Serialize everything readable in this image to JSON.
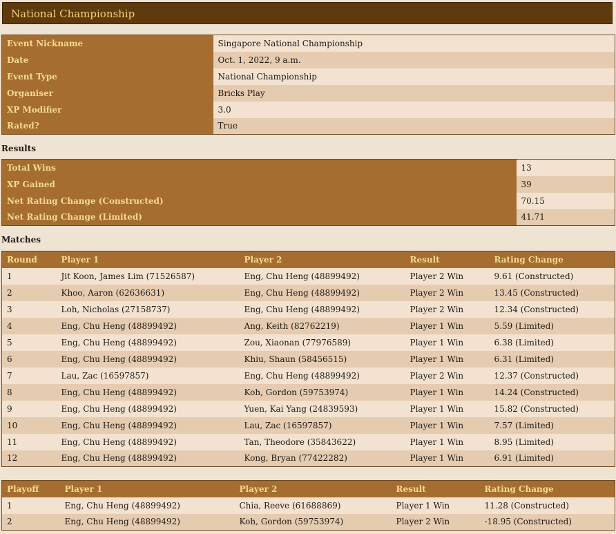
{
  "page_title": "National Championship",
  "event_details": [
    {
      "label": "Event Nickname",
      "value": "Singapore National Championship"
    },
    {
      "label": "Date",
      "value": "Oct. 1, 2022, 9 a.m."
    },
    {
      "label": "Event Type",
      "value": "National Championship"
    },
    {
      "label": "Organiser",
      "value": "Bricks Play"
    },
    {
      "label": "XP Modifier",
      "value": "3.0"
    },
    {
      "label": "Rated?",
      "value": "True"
    }
  ],
  "results": {
    "heading": "Results",
    "rows": [
      {
        "label": "Total Wins",
        "value": "13"
      },
      {
        "label": "XP Gained",
        "value": "39"
      },
      {
        "label": "Net Rating Change (Constructed)",
        "value": "70.15"
      },
      {
        "label": "Net Rating Change (Limited)",
        "value": "41.71"
      }
    ]
  },
  "matches": {
    "heading": "Matches",
    "columns": [
      "Round",
      "Player 1",
      "Player 2",
      "Result",
      "Rating Change"
    ],
    "rows": [
      [
        "1",
        "Jit Koon, James Lim (71526587)",
        "Eng, Chu Heng (48899492)",
        "Player 2 Win",
        "9.61 (Constructed)"
      ],
      [
        "2",
        "Khoo, Aaron (62636631)",
        "Eng, Chu Heng (48899492)",
        "Player 2 Win",
        "13.45 (Constructed)"
      ],
      [
        "3",
        "Loh, Nicholas (27158737)",
        "Eng, Chu Heng (48899492)",
        "Player 2 Win",
        "12.34 (Constructed)"
      ],
      [
        "4",
        "Eng, Chu Heng (48899492)",
        "Ang, Keith (82762219)",
        "Player 1 Win",
        "5.59 (Limited)"
      ],
      [
        "5",
        "Eng, Chu Heng (48899492)",
        "Zou, Xiaonan (77976589)",
        "Player 1 Win",
        "6.38 (Limited)"
      ],
      [
        "6",
        "Eng, Chu Heng (48899492)",
        "Khiu, Shaun (58456515)",
        "Player 1 Win",
        "6.31 (Limited)"
      ],
      [
        "7",
        "Lau, Zac (16597857)",
        "Eng, Chu Heng (48899492)",
        "Player 2 Win",
        "12.37 (Constructed)"
      ],
      [
        "8",
        "Eng, Chu Heng (48899492)",
        "Koh, Gordon (59753974)",
        "Player 1 Win",
        "14.24 (Constructed)"
      ],
      [
        "9",
        "Eng, Chu Heng (48899492)",
        "Yuen, Kai Yang (24839593)",
        "Player 1 Win",
        "15.82 (Constructed)"
      ],
      [
        "10",
        "Eng, Chu Heng (48899492)",
        "Lau, Zac (16597857)",
        "Player 1 Win",
        "7.57 (Limited)"
      ],
      [
        "11",
        "Eng, Chu Heng (48899492)",
        "Tan, Theodore (35843622)",
        "Player 1 Win",
        "8.95 (Limited)"
      ],
      [
        "12",
        "Eng, Chu Heng (48899492)",
        "Kong, Bryan (77422282)",
        "Player 1 Win",
        "6.91 (Limited)"
      ]
    ]
  },
  "playoffs": {
    "columns": [
      "Playoff",
      "Player 1",
      "Player 2",
      "Result",
      "Rating Change"
    ],
    "rows": [
      [
        "1",
        "Eng, Chu Heng (48899492)",
        "Chia, Reeve (61688869)",
        "Player 1 Win",
        "11.28 (Constructed)"
      ],
      [
        "2",
        "Eng, Chu Heng (48899492)",
        "Koh, Gordon (59753974)",
        "Player 2 Win",
        "-18.95 (Constructed)"
      ]
    ]
  }
}
